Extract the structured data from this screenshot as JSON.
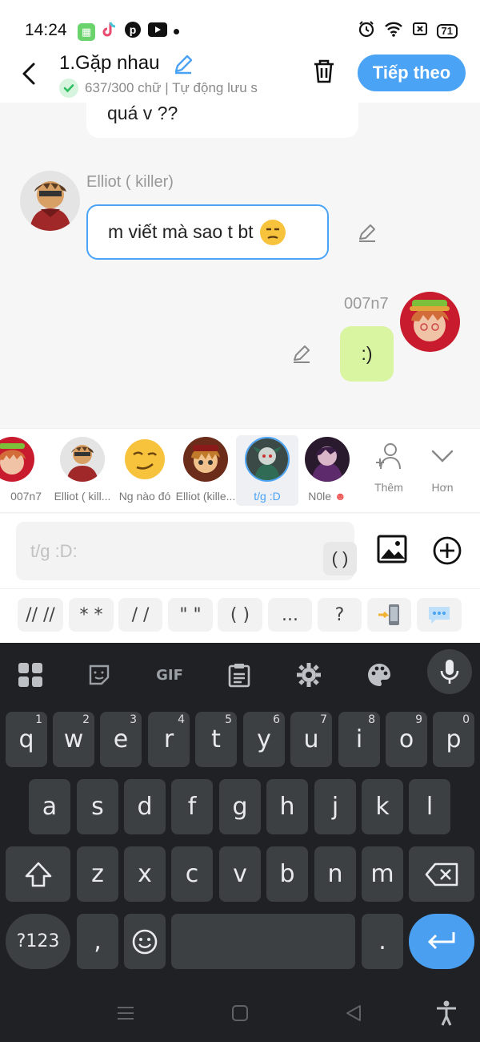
{
  "status_bar": {
    "time": "14:24",
    "battery": "71",
    "app_icons": [
      "phone-clone-icon",
      "tiktok-icon",
      "pinterest-icon",
      "youtube-icon"
    ]
  },
  "header": {
    "title": "1.Gặp nhau",
    "meta": "637/300 chữ | Tự động lưu s",
    "next_label": "Tiếp theo"
  },
  "chat": {
    "previous_message_tail": "quá v ??",
    "messages": [
      {
        "sender": "Elliot ( killer)",
        "text": "m viết mà sao t bt",
        "side": "left"
      },
      {
        "sender": "007n7",
        "text": ":)",
        "side": "right"
      }
    ]
  },
  "characters": [
    {
      "name": "007n7",
      "selected": false
    },
    {
      "name": "Elliot ( kill...",
      "selected": false
    },
    {
      "name": "Ng nào đó",
      "selected": false
    },
    {
      "name": "Elliot (kille...",
      "selected": false
    },
    {
      "name": "t/g :D",
      "selected": true
    },
    {
      "name": "N0le",
      "selected": false
    }
  ],
  "character_actions": {
    "add_label": "Thêm",
    "more_label": "Hơn"
  },
  "input": {
    "placeholder": "t/g :D:",
    "paren_button": "( )"
  },
  "symbols": [
    "// //",
    "* *",
    "/ /",
    "\" \"",
    "( )",
    "...",
    "?"
  ],
  "keyboard": {
    "row1": [
      {
        "k": "q",
        "h": "1"
      },
      {
        "k": "w",
        "h": "2"
      },
      {
        "k": "e",
        "h": "3"
      },
      {
        "k": "r",
        "h": "4"
      },
      {
        "k": "t",
        "h": "5"
      },
      {
        "k": "y",
        "h": "6"
      },
      {
        "k": "u",
        "h": "7"
      },
      {
        "k": "i",
        "h": "8"
      },
      {
        "k": "o",
        "h": "9"
      },
      {
        "k": "p",
        "h": "0"
      }
    ],
    "row2": [
      "a",
      "s",
      "d",
      "f",
      "g",
      "h",
      "j",
      "k",
      "l"
    ],
    "row3": [
      "z",
      "x",
      "c",
      "v",
      "b",
      "n",
      "m"
    ],
    "symbols_key": "?123",
    "comma": ",",
    "period": ".",
    "gif_label": "GIF"
  },
  "colors": {
    "accent": "#4aa3f5",
    "user_bubble": "#d9f5a1",
    "keyboard_bg": "#202124",
    "key_bg": "#3c4043"
  }
}
